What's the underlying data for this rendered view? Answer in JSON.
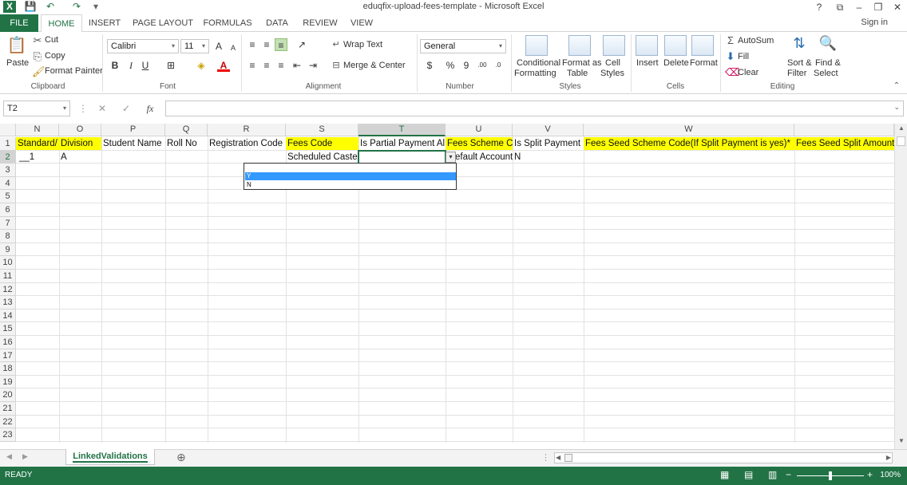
{
  "title_bar": {
    "title": "eduqfix-upload-fees-template - Microsoft Excel",
    "help": "?",
    "ribbon_options": "⧉",
    "minimize": "–",
    "restore": "❐",
    "close": "✕",
    "qat": {
      "app_icon": "X",
      "save": "💾",
      "undo": "↶",
      "redo": "↷",
      "customize": "▾"
    }
  },
  "tabs": [
    "FILE",
    "HOME",
    "INSERT",
    "PAGE LAYOUT",
    "FORMULAS",
    "DATA",
    "REVIEW",
    "VIEW"
  ],
  "sign_in": "Sign in",
  "ribbon": {
    "clipboard": {
      "label": "Clipboard",
      "paste": "Paste",
      "cut": "Cut",
      "copy": "Copy",
      "format_painter": "Format Painter"
    },
    "font": {
      "label": "Font",
      "font_name": "Calibri",
      "font_size": "11",
      "bold": "B",
      "italic": "I",
      "underline": "U",
      "grow": "A",
      "shrink": "A"
    },
    "alignment": {
      "label": "Alignment",
      "wrap_text": "Wrap Text",
      "merge_center": "Merge & Center"
    },
    "number": {
      "label": "Number",
      "format": "General",
      "currency": "$",
      "percent": "%",
      "comma": "9",
      "inc_dec": ".00",
      "dec_dec": ".0"
    },
    "styles": {
      "label": "Styles",
      "conditional": [
        "Conditional",
        "Formatting"
      ],
      "format_table": [
        "Format as",
        "Table"
      ],
      "cell_styles": [
        "Cell",
        "Styles"
      ]
    },
    "cells": {
      "label": "Cells",
      "insert": "Insert",
      "delete": "Delete",
      "format": "Format"
    },
    "editing": {
      "label": "Editing",
      "autosum": "AutoSum",
      "fill": "Fill",
      "clear": "Clear",
      "sort_filter": [
        "Sort &",
        "Filter"
      ],
      "find_select": [
        "Find &",
        "Select"
      ]
    }
  },
  "formula_bar": {
    "name_box": "T2",
    "cancel": "✕",
    "enter": "✓",
    "fx": "fx",
    "value": ""
  },
  "grid": {
    "columns": [
      {
        "letter": "N",
        "header": "Standard/",
        "highlight": true,
        "r2": "__1"
      },
      {
        "letter": "O",
        "header": "Division",
        "highlight": true,
        "r2": "A"
      },
      {
        "letter": "P",
        "header": "Student Name",
        "highlight": false,
        "r2": ""
      },
      {
        "letter": "Q",
        "header": "Roll No",
        "highlight": false,
        "r2": ""
      },
      {
        "letter": "R",
        "header": "Registration Code",
        "highlight": false,
        "r2": ""
      },
      {
        "letter": "S",
        "header": "Fees Code",
        "highlight": true,
        "r2": "Scheduled Caste"
      },
      {
        "letter": "T",
        "header": "Is Partial Payment Al",
        "highlight": false,
        "r2": ""
      },
      {
        "letter": "U",
        "header": "Fees Scheme Co",
        "highlight": true,
        "r2": "efault Account"
      },
      {
        "letter": "V",
        "header": "Is Split Payment",
        "highlight": false,
        "r2": "N"
      },
      {
        "letter": "W",
        "header": "Fees Seed Scheme Code(If Split Payment is yes)*",
        "highlight": true,
        "r2": ""
      },
      {
        "letter": "",
        "header": "Fees Seed Split Amount",
        "highlight": true,
        "r2": ""
      }
    ],
    "rows": [
      "1",
      "2",
      "3",
      "4",
      "5",
      "6",
      "7",
      "8",
      "9",
      "10",
      "11",
      "12",
      "13",
      "14",
      "15",
      "16",
      "17",
      "18",
      "19",
      "20",
      "21",
      "22",
      "23"
    ],
    "selected_column": "T",
    "selected_row": "2",
    "dropdown_options": [
      "Y",
      "N"
    ],
    "dropdown_highlighted": "Y"
  },
  "sheet_tabs": {
    "active": "LinkedValidations",
    "add": "⊕"
  },
  "status_bar": {
    "ready": "READY",
    "zoom": "100%"
  },
  "colors": {
    "excel_green": "#217346",
    "header_yellow": "#ffff00",
    "highlight_blue": "#3399ff"
  }
}
